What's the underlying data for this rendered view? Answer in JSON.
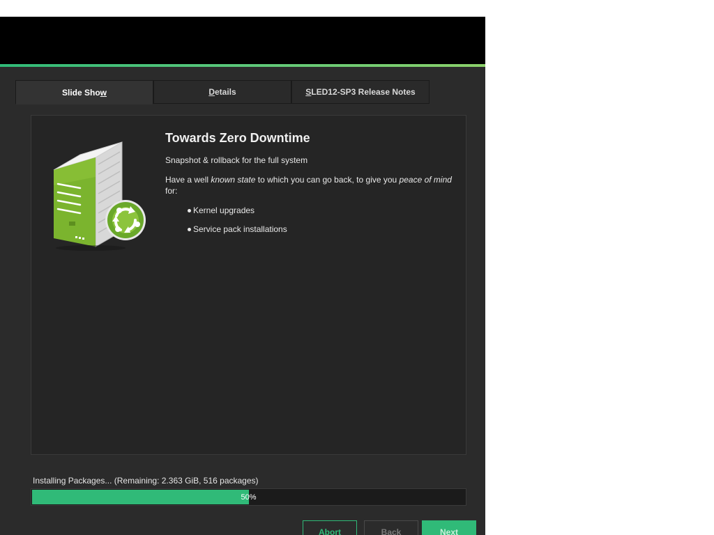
{
  "tabs": [
    {
      "label_pre": "Slide Sho",
      "label_ul": "w",
      "label_post": "",
      "active": true
    },
    {
      "label_pre": "",
      "label_ul": "D",
      "label_post": "etails",
      "active": false
    },
    {
      "label_pre": "",
      "label_ul": "S",
      "label_post": "LED12-SP3 Release Notes",
      "active": false
    }
  ],
  "slide": {
    "title": "Towards Zero Downtime",
    "subtitle": "Snapshot & rollback for the full system",
    "para_1": "Have a well ",
    "para_em1": "known state",
    "para_2": " to which you can go back, to give you ",
    "para_em2": "peace of mind",
    "para_3": " for:",
    "bullets": [
      "Kernel upgrades",
      "Service pack installations"
    ],
    "illustration": "server-snapshot-rollback-icon"
  },
  "status": {
    "text": "Installing Packages... (Remaining: 2.363 GiB, 516 packages)",
    "progress_percent": 50,
    "progress_label": "50%"
  },
  "buttons": {
    "abort": "Abort",
    "back": "Back",
    "next": "Next"
  },
  "colors": {
    "accent": "#30ba78",
    "background": "#2b2b2b",
    "header": "#000000"
  }
}
